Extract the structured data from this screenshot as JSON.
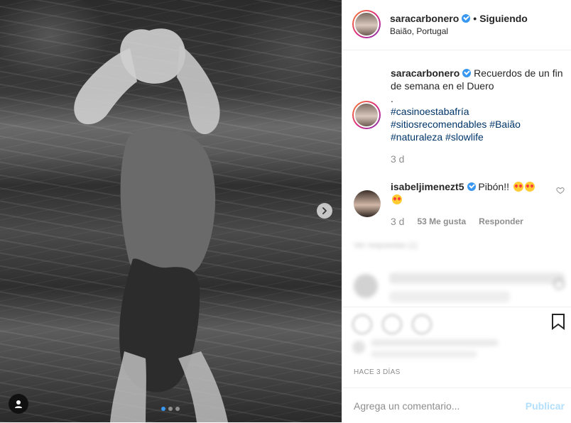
{
  "header": {
    "username": "saracarbonero",
    "separator": "•",
    "follow_status": "Siguiendo",
    "location": "Baião, Portugal"
  },
  "caption": {
    "username": "saracarbonero",
    "text": "Recuerdos de un fin de semana en el Duero",
    "dot": ".",
    "hashtags_line1": "#casinoestabafría",
    "hashtags_line2": "#sitiosrecomendables #Baião",
    "hashtags_line3": "#naturaleza #slowlife",
    "time": "3 d"
  },
  "comment": {
    "username": "isabeljimenezt5",
    "text": "Pibón!!",
    "time": "3 d",
    "likes": "53 Me gusta",
    "reply": "Responder"
  },
  "blurred": {
    "view_replies": "Ver respuestas (1)"
  },
  "footer": {
    "timestamp": "HACE 3 DÍAS",
    "add_comment_placeholder": "Agrega un comentario...",
    "publish": "Publicar"
  },
  "icons": {
    "verified": "verified-badge-icon",
    "next": "chevron-right-icon",
    "user_tag": "person-icon",
    "bookmark": "bookmark-icon",
    "heart": "heart-icon"
  },
  "colors": {
    "link": "#003569",
    "accent": "#3897f0",
    "muted": "#8e8e8e",
    "publish_disabled": "#b2dffc"
  }
}
